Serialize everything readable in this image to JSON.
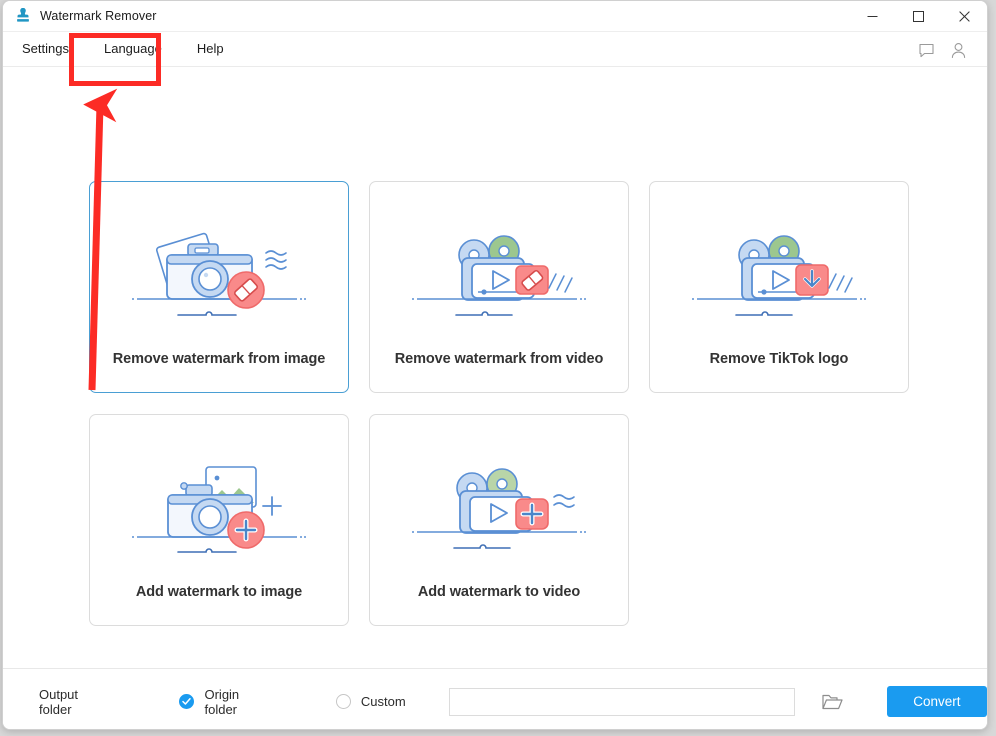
{
  "window": {
    "title": "Watermark Remover",
    "app_icon": "stamp-icon",
    "controls": {
      "minimize": "minimize-icon",
      "maximize": "maximize-icon",
      "close": "close-icon"
    }
  },
  "menubar": {
    "items": [
      {
        "label": "Settings",
        "name": "menu-settings"
      },
      {
        "label": "Language",
        "name": "menu-language"
      },
      {
        "label": "Help",
        "name": "menu-help"
      }
    ],
    "icons": [
      {
        "name": "feedback-icon"
      },
      {
        "name": "account-icon"
      }
    ]
  },
  "main": {
    "cards": [
      {
        "label": "Remove watermark from image",
        "art": "camera-eraser-icon",
        "selected": true
      },
      {
        "label": "Remove watermark from video",
        "art": "video-eraser-icon",
        "selected": false
      },
      {
        "label": "Remove TikTok logo",
        "art": "video-download-icon",
        "selected": false
      },
      {
        "label": "Add watermark to image",
        "art": "camera-plus-icon",
        "selected": false
      },
      {
        "label": "Add watermark to video",
        "art": "video-plus-icon",
        "selected": false
      }
    ]
  },
  "bottombar": {
    "output_label": "Output folder",
    "origin_radio": {
      "label": "Origin folder",
      "checked": true
    },
    "custom_radio": {
      "label": "Custom",
      "checked": false
    },
    "custom_path": {
      "value": "",
      "placeholder": ""
    },
    "browse_icon": "folder-open-icon",
    "convert_label": "Convert"
  },
  "annotation": {
    "highlight_target": "Language",
    "arrow_color": "#fc2b25",
    "rect_color": "#fc2b25"
  },
  "colors": {
    "accent_blue": "#1a9bf0",
    "selected_card_border": "#4a9fd4",
    "annotation_red": "#fc2b25",
    "text_dark": "#333333"
  }
}
